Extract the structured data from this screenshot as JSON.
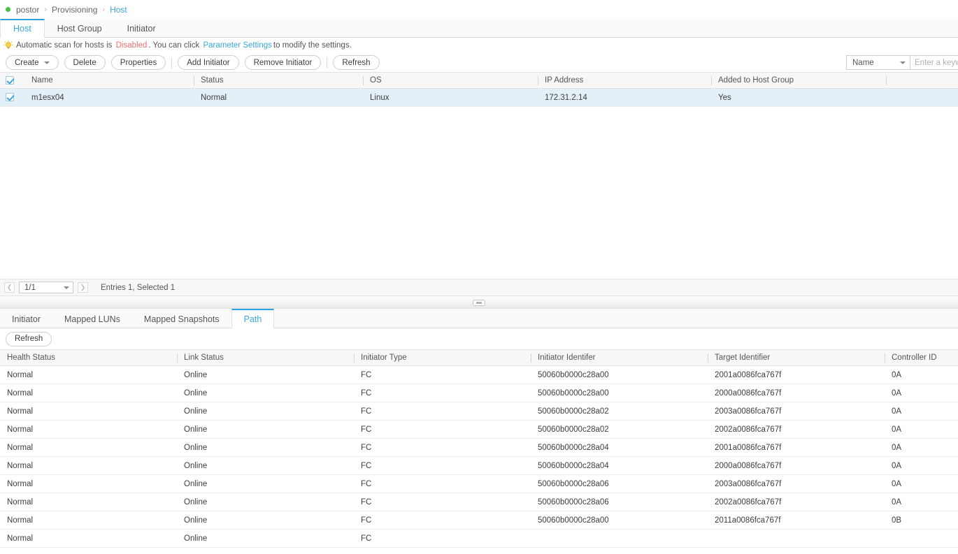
{
  "breadcrumb": {
    "status_icon": "status-dot-green",
    "status_color": "#3ec43e",
    "items": [
      "postor",
      "Provisioning",
      "Host"
    ],
    "separator": "›"
  },
  "main_tabs": {
    "items": [
      {
        "label": "Host",
        "active": true
      },
      {
        "label": "Host Group",
        "active": false
      },
      {
        "label": "Initiator",
        "active": false
      }
    ]
  },
  "notice": {
    "icon": "lightbulb-icon",
    "text_before": "Automatic scan for hosts is",
    "status": "Disabled",
    "status_color": "#e8706f",
    "text_middle": ". You can click",
    "link": "Parameter Settings",
    "link_color": "#3aa8dd",
    "text_after": "to modify the settings."
  },
  "toolbar": {
    "create_label": "Create",
    "delete_label": "Delete",
    "properties_label": "Properties",
    "add_initiator_label": "Add Initiator",
    "remove_initiator_label": "Remove Initiator",
    "refresh_label": "Refresh"
  },
  "search": {
    "selected_field": "Name",
    "placeholder": "Enter a keyword",
    "value": ""
  },
  "host_table": {
    "columns": [
      "Name",
      "Status",
      "OS",
      "IP Address",
      "Added to Host Group",
      ""
    ],
    "header_checkbox_checked": true,
    "rows": [
      {
        "checked": true,
        "selected": true,
        "name": "m1esx04",
        "status": "Normal",
        "os": "Linux",
        "ip_address": "172.31.2.14",
        "added_to_host_group": "Yes",
        "extra": ""
      }
    ]
  },
  "pager": {
    "prev_icon": "chevron-left-icon",
    "next_icon": "chevron-right-icon",
    "page_value": "1/1",
    "info": "Entries 1, Selected 1"
  },
  "splitter": {
    "handle_icon": "collapse-handle-icon"
  },
  "sub_tabs": {
    "items": [
      {
        "label": "Initiator",
        "active": false
      },
      {
        "label": "Mapped LUNs",
        "active": false
      },
      {
        "label": "Mapped Snapshots",
        "active": false
      },
      {
        "label": "Path",
        "active": true
      }
    ]
  },
  "sub_toolbar": {
    "refresh_label": "Refresh"
  },
  "path_table": {
    "columns": [
      "Health Status",
      "Link Status",
      "Initiator Type",
      "Initiator Identifer",
      "Target Identifier",
      "Controller ID"
    ],
    "rows": [
      {
        "health_status": "Normal",
        "link_status": "Online",
        "initiator_type": "FC",
        "initiator_identifier": "50060b0000c28a00",
        "target_identifier": "2001a0086fca767f",
        "controller_id": "0A"
      },
      {
        "health_status": "Normal",
        "link_status": "Online",
        "initiator_type": "FC",
        "initiator_identifier": "50060b0000c28a00",
        "target_identifier": "2000a0086fca767f",
        "controller_id": "0A"
      },
      {
        "health_status": "Normal",
        "link_status": "Online",
        "initiator_type": "FC",
        "initiator_identifier": "50060b0000c28a02",
        "target_identifier": "2003a0086fca767f",
        "controller_id": "0A"
      },
      {
        "health_status": "Normal",
        "link_status": "Online",
        "initiator_type": "FC",
        "initiator_identifier": "50060b0000c28a02",
        "target_identifier": "2002a0086fca767f",
        "controller_id": "0A"
      },
      {
        "health_status": "Normal",
        "link_status": "Online",
        "initiator_type": "FC",
        "initiator_identifier": "50060b0000c28a04",
        "target_identifier": "2001a0086fca767f",
        "controller_id": "0A"
      },
      {
        "health_status": "Normal",
        "link_status": "Online",
        "initiator_type": "FC",
        "initiator_identifier": "50060b0000c28a04",
        "target_identifier": "2000a0086fca767f",
        "controller_id": "0A"
      },
      {
        "health_status": "Normal",
        "link_status": "Online",
        "initiator_type": "FC",
        "initiator_identifier": "50060b0000c28a06",
        "target_identifier": "2003a0086fca767f",
        "controller_id": "0A"
      },
      {
        "health_status": "Normal",
        "link_status": "Online",
        "initiator_type": "FC",
        "initiator_identifier": "50060b0000c28a06",
        "target_identifier": "2002a0086fca767f",
        "controller_id": "0A"
      },
      {
        "health_status": "Normal",
        "link_status": "Online",
        "initiator_type": "FC",
        "initiator_identifier": "50060b0000c28a00",
        "target_identifier": "2011a0086fca767f",
        "controller_id": "0B"
      },
      {
        "health_status": "Normal",
        "link_status": "Online",
        "initiator_type": "FC",
        "initiator_identifier": "",
        "target_identifier": "",
        "controller_id": ""
      }
    ]
  }
}
